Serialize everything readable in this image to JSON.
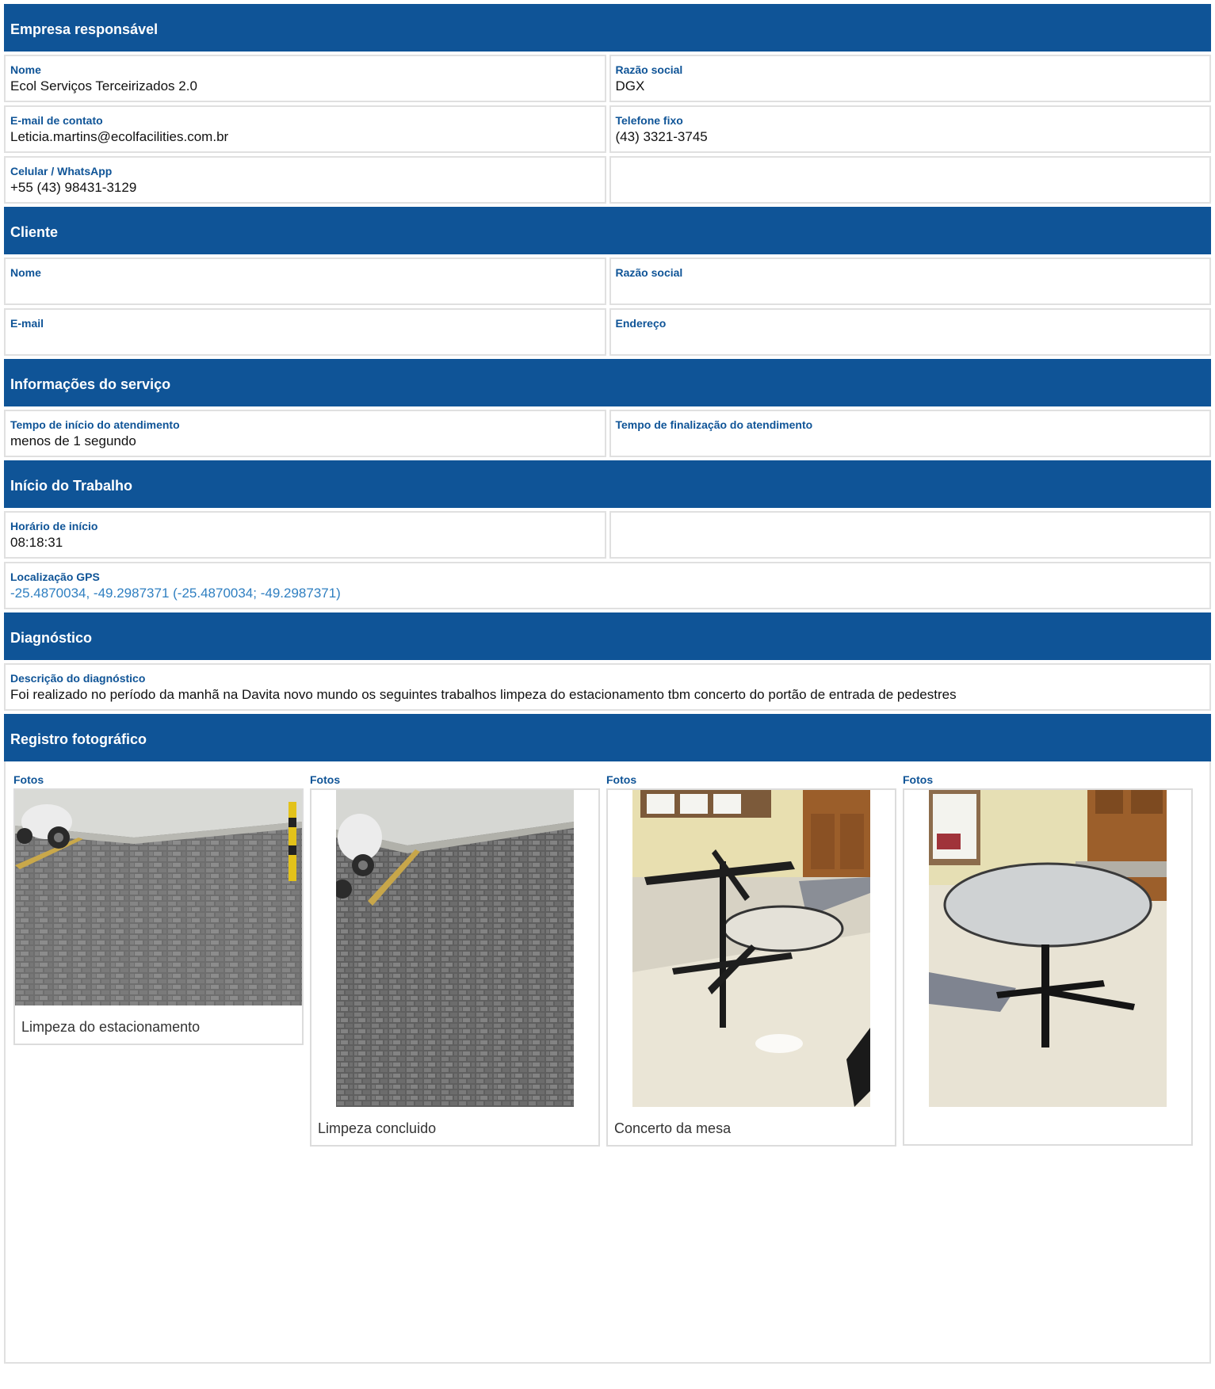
{
  "empresa": {
    "title": "Empresa responsável",
    "nome_label": "Nome",
    "nome": "Ecol Serviços Terceirizados 2.0",
    "razao_label": "Razão social",
    "razao": "DGX",
    "email_label": "E-mail de contato",
    "email": "Leticia.martins@ecolfacilities.com.br",
    "telefone_label": "Telefone fixo",
    "telefone": "(43) 3321-3745",
    "celular_label": "Celular / WhatsApp",
    "celular": "+55 (43) 98431-3129"
  },
  "cliente": {
    "title": "Cliente",
    "nome_label": "Nome",
    "razao_label": "Razão social",
    "email_label": "E-mail",
    "endereco_label": "Endereço"
  },
  "servico": {
    "title": "Informações do serviço",
    "inicio_label": "Tempo de início do atendimento",
    "inicio": "menos de 1 segundo",
    "fim_label": "Tempo de finalização do atendimento"
  },
  "trabalho": {
    "title": "Início do Trabalho",
    "horario_label": "Horário de início",
    "horario": "08:18:31",
    "gps_label": "Localização GPS",
    "gps": "-25.4870034, -49.2987371 (-25.4870034; -49.2987371)"
  },
  "diagnostico": {
    "title": "Diagnóstico",
    "descricao_label": "Descrição do diagnóstico",
    "descricao": "Foi realizado no período da manhã na Davita novo mundo os seguintes trabalhos limpeza do estacionamento tbm concerto do portão de entrada de pedestres"
  },
  "fotos": {
    "title": "Registro fotográfico",
    "items": [
      {
        "label": "Fotos",
        "caption": "Limpeza do estacionamento",
        "icon": "parking-lot-photo"
      },
      {
        "label": "Fotos",
        "caption": "Limpeza concluido",
        "icon": "parking-lot-photo"
      },
      {
        "label": "Fotos",
        "caption": "Concerto da mesa",
        "icon": "table-repair-photo"
      },
      {
        "label": "Fotos",
        "caption": "",
        "icon": "round-table-photo"
      }
    ]
  },
  "colors": {
    "header": "#0f5497",
    "label": "#0f5497",
    "link": "#2f7fc1"
  }
}
